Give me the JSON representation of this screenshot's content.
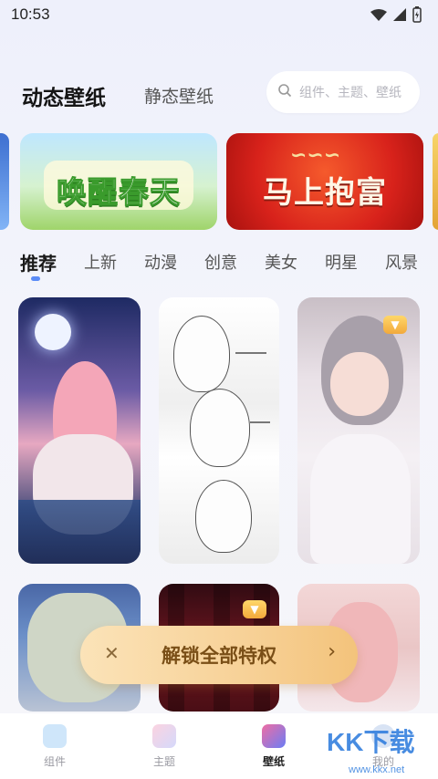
{
  "status_bar": {
    "time": "10:53",
    "icons": [
      "wifi-icon",
      "signal-icon",
      "battery-icon"
    ]
  },
  "header": {
    "tabs": [
      {
        "label": "动态壁纸",
        "active": true
      },
      {
        "label": "静态壁纸",
        "active": false
      }
    ],
    "search": {
      "placeholder": "组件、主题、壁纸"
    }
  },
  "banners": [
    {
      "title": "唤醒春天",
      "theme": "spring"
    },
    {
      "title": "马上抱富",
      "theme": "new-year"
    }
  ],
  "categories": [
    {
      "label": "推荐",
      "active": true
    },
    {
      "label": "上新"
    },
    {
      "label": "动漫"
    },
    {
      "label": "创意"
    },
    {
      "label": "美女"
    },
    {
      "label": "明星"
    },
    {
      "label": "风景"
    }
  ],
  "wallpapers": [
    {
      "name": "anime-girl-moon-bath",
      "premium": false
    },
    {
      "name": "sketch-anime-characters",
      "premium": false
    },
    {
      "name": "anime-girl-white-dress",
      "premium": true
    },
    {
      "name": "anime-boy-green-hair",
      "premium": false
    },
    {
      "name": "dark-red-curtain",
      "premium": true
    },
    {
      "name": "pink-hair-girl",
      "premium": false
    }
  ],
  "unlock_popup": {
    "label": "解锁全部特权",
    "close_icon": "close-icon",
    "chevron_icon": "chevron-right-icon"
  },
  "bottom_nav": [
    {
      "label": "组件",
      "icon": "widget-icon",
      "active": false
    },
    {
      "label": "主题",
      "icon": "theme-icon",
      "active": false
    },
    {
      "label": "壁纸",
      "icon": "wallpaper-icon",
      "active": true
    },
    {
      "label": "我的",
      "icon": "profile-icon",
      "active": false
    }
  ],
  "watermark": {
    "text": "KK下载",
    "sub": "www.kkx.net"
  },
  "colors": {
    "accent": "#5b8cf7",
    "unlock_bg": "#f7d197",
    "unlock_text": "#7a4f17"
  }
}
